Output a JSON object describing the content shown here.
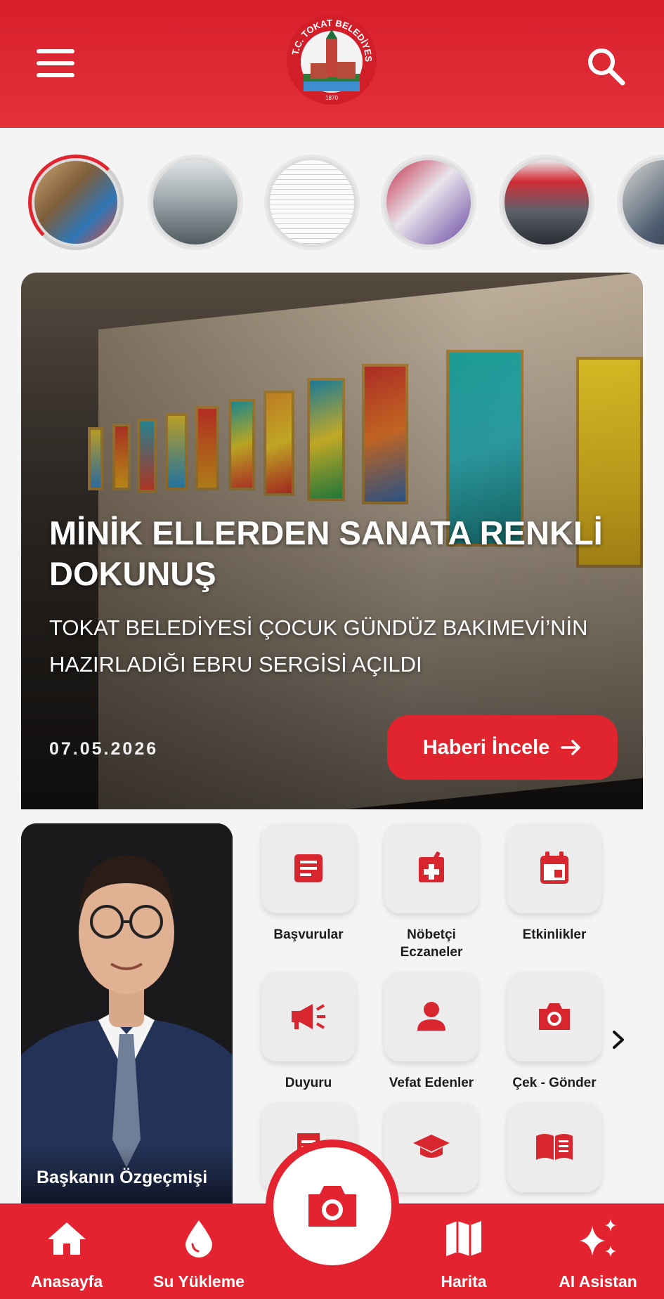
{
  "header": {
    "logo_text": "T.C. TOKAT BELEDİYESİ",
    "logo_year": "1870",
    "menu_icon": "hamburger-menu-icon",
    "search_icon": "search-icon"
  },
  "stories": [
    {
      "name": "story-1",
      "active": true
    },
    {
      "name": "story-2",
      "active": false
    },
    {
      "name": "story-3",
      "active": false
    },
    {
      "name": "story-4",
      "active": false
    },
    {
      "name": "story-5",
      "active": false
    },
    {
      "name": "story-6",
      "active": false
    }
  ],
  "hero": {
    "title": "MİNİK ELLERDEN SANATA RENKLİ DOKUNUŞ",
    "subtitle": "TOKAT BELEDİYESİ ÇOCUK GÜNDÜZ BAKIMEVİ’NİN HAZIRLADIĞI EBRU SERGİSİ AÇILDI",
    "date": "07.05.2026",
    "button_label": "Haberi İncele",
    "button_icon": "arrow-right-icon"
  },
  "mayor": {
    "label": "Başkanın Özgeçmişi"
  },
  "grid": [
    {
      "label": "Başvurular",
      "icon": "document-icon"
    },
    {
      "label": "Nöbetçi Eczaneler",
      "icon": "pharmacy-icon"
    },
    {
      "label": "Etkinlikler",
      "icon": "calendar-icon"
    },
    {
      "label": "Duyuru",
      "icon": "megaphone-icon"
    },
    {
      "label": "Vefat Edenler",
      "icon": "person-icon"
    },
    {
      "label": "Çek - Gönder",
      "icon": "camera-icon"
    },
    {
      "label": "",
      "icon": "receipt-icon"
    },
    {
      "label": "",
      "icon": "graduation-cap-icon"
    },
    {
      "label": "",
      "icon": "book-icon"
    }
  ],
  "bottom_nav": {
    "items": [
      {
        "label": "Anasayfa",
        "icon": "home-icon"
      },
      {
        "label": "Su Yükleme",
        "icon": "water-drop-icon"
      },
      {
        "label": "Harita",
        "icon": "map-icon"
      },
      {
        "label": "AI Asistan",
        "icon": "sparkles-icon"
      }
    ],
    "fab_icon": "camera-icon"
  },
  "colors": {
    "brand_red": "#e3232f",
    "icon_red": "#d8262f",
    "tile_bg": "#ececec"
  }
}
